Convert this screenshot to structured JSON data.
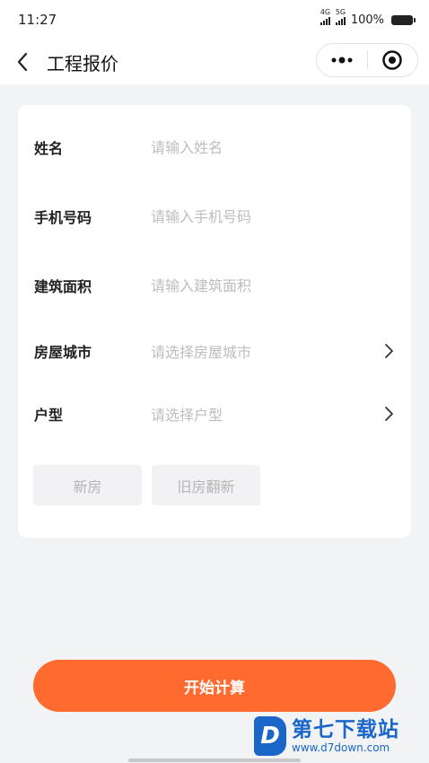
{
  "status_bar": {
    "time": "11:27",
    "signal1_label": "4G",
    "signal2_label": "5G",
    "battery_text": "100%"
  },
  "nav": {
    "title": "工程报价",
    "back_icon": "chevron-left-icon",
    "more_icon": "more-dots-icon",
    "close_icon": "target-circle-icon"
  },
  "form": {
    "name": {
      "label": "姓名",
      "placeholder": "请输入姓名",
      "value": ""
    },
    "phone": {
      "label": "手机号码",
      "placeholder": "请输入手机号码",
      "value": ""
    },
    "area": {
      "label": "建筑面积",
      "placeholder": "请输入建筑面积",
      "value": ""
    },
    "city": {
      "label": "房屋城市",
      "placeholder": "请选择房屋城市"
    },
    "layout": {
      "label": "户型",
      "placeholder": "请选择户型"
    },
    "type_options": [
      "新房",
      "旧房翻新"
    ]
  },
  "calc_button": {
    "label": "开始计算",
    "color": "#ff6a2e"
  },
  "watermark": {
    "title": "第七下载站",
    "url": "www.d7down.com",
    "logo": "D",
    "color": "#1a66c9"
  }
}
